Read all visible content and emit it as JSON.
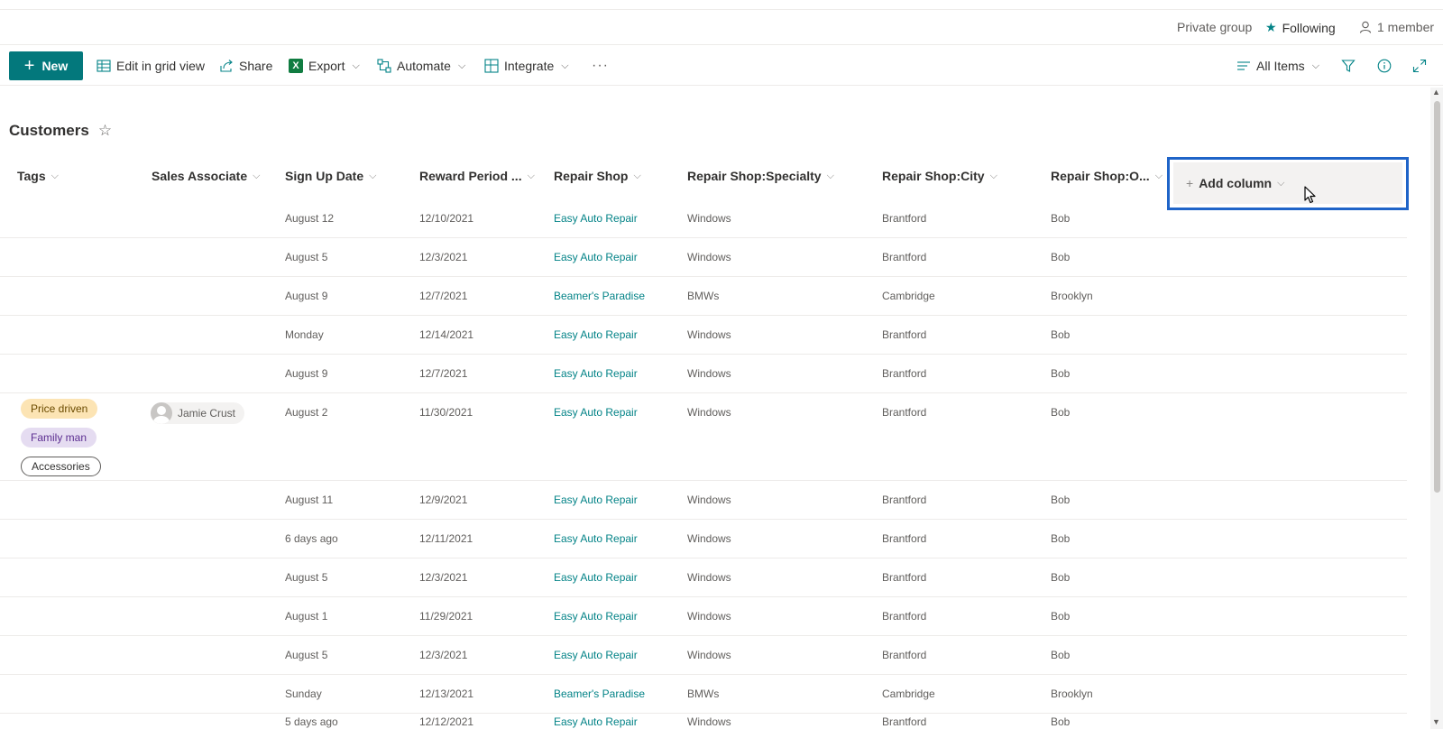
{
  "groupbar": {
    "privacy": "Private group",
    "following": "Following",
    "members": "1 member"
  },
  "commandbar": {
    "new_label": "New",
    "edit_grid_label": "Edit in grid view",
    "share_label": "Share",
    "export_label": "Export",
    "automate_label": "Automate",
    "integrate_label": "Integrate",
    "more_label": "···",
    "view_label": "All Items"
  },
  "list": {
    "title": "Customers",
    "columns": [
      "Tags",
      "Sales Associate",
      "Sign Up Date",
      "Reward Period ...",
      "Repair Shop",
      "Repair Shop:Specialty",
      "Repair Shop:City",
      "Repair Shop:O..."
    ],
    "add_column_label": "Add column",
    "rows": [
      {
        "signup": "August 12",
        "reward": "12/10/2021",
        "shop": "Easy Auto Repair",
        "specialty": "Windows",
        "city": "Brantford",
        "owner": "Bob"
      },
      {
        "signup": "August 5",
        "reward": "12/3/2021",
        "shop": "Easy Auto Repair",
        "specialty": "Windows",
        "city": "Brantford",
        "owner": "Bob"
      },
      {
        "signup": "August 9",
        "reward": "12/7/2021",
        "shop": "Beamer's Paradise",
        "specialty": "BMWs",
        "city": "Cambridge",
        "owner": "Brooklyn"
      },
      {
        "signup": "Monday",
        "reward": "12/14/2021",
        "shop": "Easy Auto Repair",
        "specialty": "Windows",
        "city": "Brantford",
        "owner": "Bob"
      },
      {
        "signup": "August 9",
        "reward": "12/7/2021",
        "shop": "Easy Auto Repair",
        "specialty": "Windows",
        "city": "Brantford",
        "owner": "Bob"
      },
      {
        "signup": "August 2",
        "reward": "11/30/2021",
        "shop": "Easy Auto Repair",
        "specialty": "Windows",
        "city": "Brantford",
        "owner": "Bob",
        "tags": [
          "Price driven",
          "Family man",
          "Accessories"
        ],
        "associate": "Jamie Crust"
      },
      {
        "signup": "August 11",
        "reward": "12/9/2021",
        "shop": "Easy Auto Repair",
        "specialty": "Windows",
        "city": "Brantford",
        "owner": "Bob"
      },
      {
        "signup": "6 days ago",
        "reward": "12/11/2021",
        "shop": "Easy Auto Repair",
        "specialty": "Windows",
        "city": "Brantford",
        "owner": "Bob"
      },
      {
        "signup": "August 5",
        "reward": "12/3/2021",
        "shop": "Easy Auto Repair",
        "specialty": "Windows",
        "city": "Brantford",
        "owner": "Bob"
      },
      {
        "signup": "August 1",
        "reward": "11/29/2021",
        "shop": "Easy Auto Repair",
        "specialty": "Windows",
        "city": "Brantford",
        "owner": "Bob"
      },
      {
        "signup": "August 5",
        "reward": "12/3/2021",
        "shop": "Easy Auto Repair",
        "specialty": "Windows",
        "city": "Brantford",
        "owner": "Bob"
      },
      {
        "signup": "Sunday",
        "reward": "12/13/2021",
        "shop": "Beamer's Paradise",
        "specialty": "BMWs",
        "city": "Cambridge",
        "owner": "Brooklyn"
      },
      {
        "signup": "5 days ago",
        "reward": "12/12/2021",
        "shop": "Easy Auto Repair",
        "specialty": "Windows",
        "city": "Brantford",
        "owner": "Bob"
      }
    ]
  },
  "colors": {
    "accent": "#03787c",
    "link": "#038387",
    "highlight_box": "#1f64c8"
  }
}
